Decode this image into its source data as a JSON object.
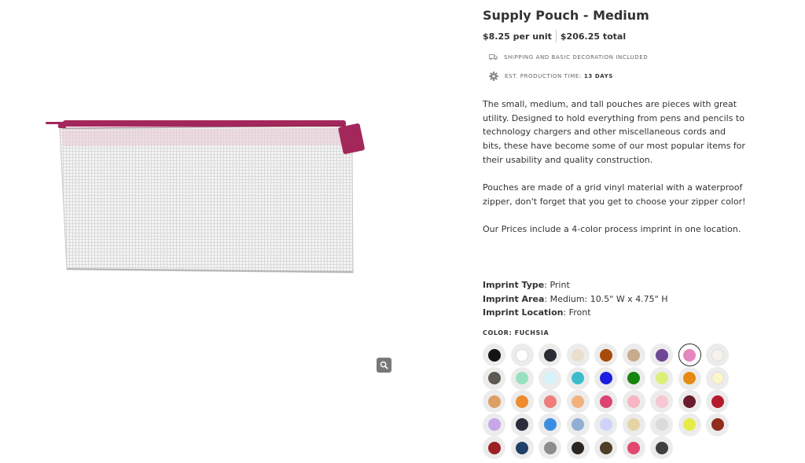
{
  "product": {
    "title": "Supply Pouch - Medium",
    "price_unit": "$8.25 per unit",
    "price_total": "$206.25 total",
    "shipping_note": "SHIPPING AND BASIC DECORATION INCLUDED",
    "production_label": "EST. PRODUCTION TIME:",
    "production_value": "13 DAYS",
    "description": [
      "The small, medium, and tall pouches are pieces with great utility. Designed to hold everything from pens and pencils to technology chargers and other miscellaneous cords and bits, these have become some of our most popular items for their usability and quality construction.",
      "Pouches are made of a grid vinyl material with a waterproof zipper, don't forget that you get to choose your zipper color!",
      "Our Prices include a 4-color process imprint in one location."
    ],
    "imprint_type_label": "Imprint Type",
    "imprint_type_value": ": Print",
    "imprint_area_label": "Imprint Area",
    "imprint_area_value": ": Medium: 10.5\" W x 4.75\" H",
    "imprint_location_label": "Imprint Location",
    "imprint_location_value": ": Front",
    "color_label": "COLOR: FUCHSIA"
  },
  "image": {
    "zipper_color": "#a3275a",
    "zoom_icon": "magnifier-icon"
  },
  "icons": {
    "shipping": "truck-icon",
    "production": "gear-icon"
  },
  "colors": [
    "#151515",
    "#ffffff",
    "#2a2c33",
    "#e8e0cd",
    "#a84a08",
    "#c8ab8c",
    "#6e4796",
    "#e486bf",
    "#f4f2ea",
    "#5c5a52",
    "#98e0c0",
    "#d6f3fa",
    "#3cbccb",
    "#1d1ee0",
    "#16850f",
    "#dcef7a",
    "#e58a12",
    "#fbf6c7",
    "#dca064",
    "#ef8a2e",
    "#ee7d7b",
    "#f2b27f",
    "#dc4472",
    "#f7b6c3",
    "#f7c7d2",
    "#6a1d2d",
    "#b41a2d",
    "#c7a7ea",
    "#2b2c3c",
    "#3a8de3",
    "#90aed4",
    "#cfd2fa",
    "#e6d4a6",
    "#dadada",
    "#e6eb47",
    "#922c1d",
    "#9a2124",
    "#1f4068",
    "#8c8c8c",
    "#2d2520",
    "#4c4128",
    "#e24770",
    "#3f3f3f"
  ],
  "selected_color_index": 7
}
